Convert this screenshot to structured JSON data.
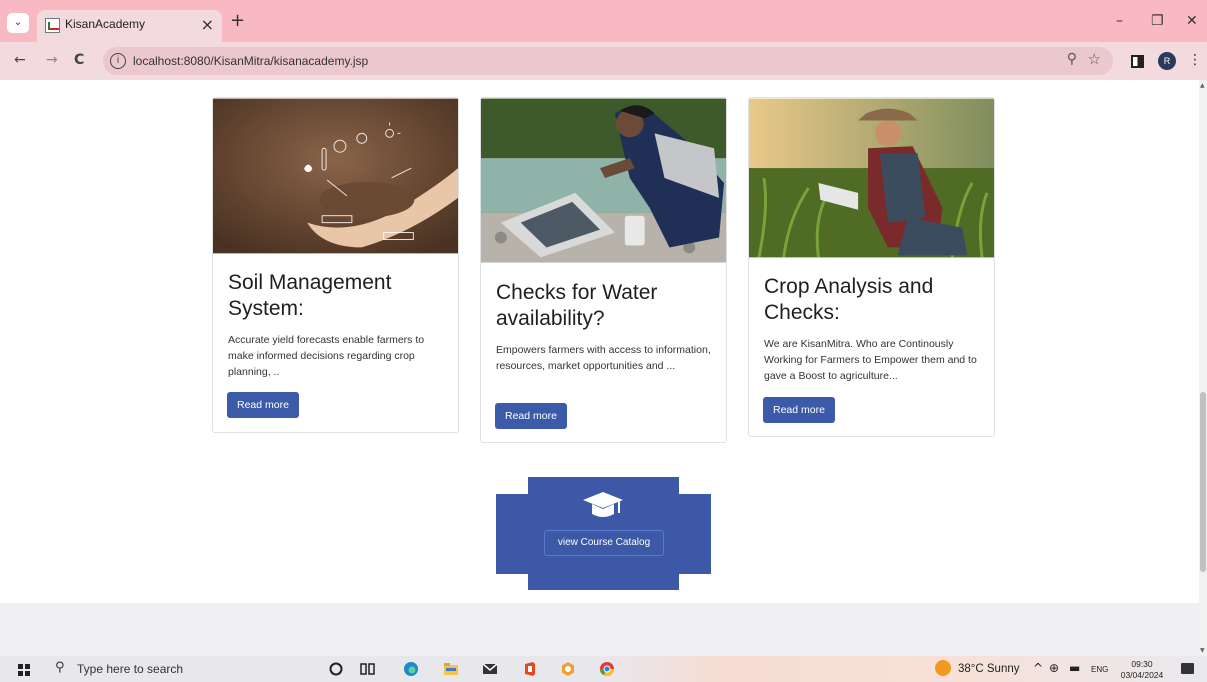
{
  "browser": {
    "tab_title": "KisanAcademy",
    "tab_close": "×",
    "new_tab": "+",
    "url": "localhost:8080/KisanMitra/kisanacademy.jsp",
    "profile_initial": "R",
    "window_controls": {
      "minimize": "–",
      "restore": "❐",
      "close": "✕"
    }
  },
  "cards": [
    {
      "title": "Soil Management System:",
      "description": "Accurate yield forecasts enable farmers to make informed decisions regarding crop planning, ..",
      "button": "Read more",
      "image": "hands-holding-soil"
    },
    {
      "title": "Checks for Water availability?",
      "description": "Empowers farmers with access to information, resources, market opportunities and ...",
      "button": "Read more",
      "image": "woman-testing-water"
    },
    {
      "title": "Crop Analysis and Checks:",
      "description": "We are KisanMitra. Who are Continously Working for Farmers to Empower them and to gave a Boost to agriculture...",
      "button": "Read more",
      "image": "farmer-in-cornfield"
    }
  ],
  "catalog": {
    "button": "view Course Catalog",
    "icon": "graduation-cap-icon"
  },
  "taskbar": {
    "search_placeholder": "Type here to search",
    "weather": "38°C  Sunny",
    "language": "ENG",
    "time": "09:30",
    "date": "03/04/2024"
  },
  "colors": {
    "accent": "#3b5aa8",
    "tab_bar": "#f8b9c3",
    "address_bar": "#f3dadf"
  }
}
